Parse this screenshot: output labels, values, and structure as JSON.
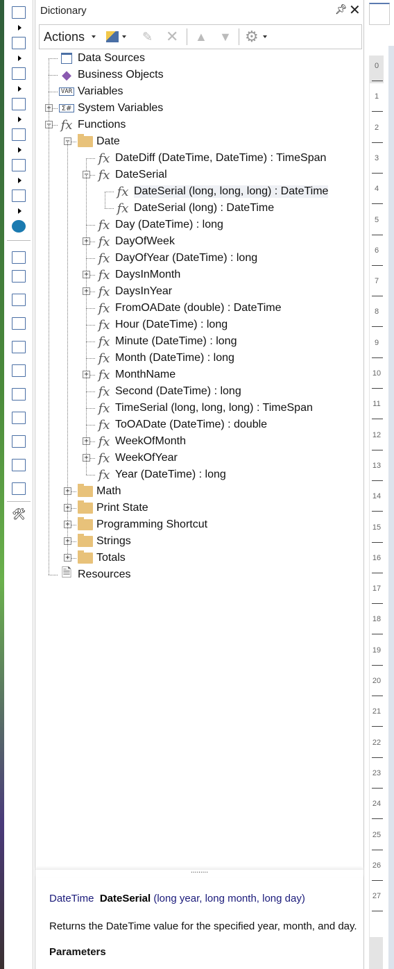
{
  "panel": {
    "title": "Dictionary",
    "pin_icon": "pin-icon",
    "close_icon": "close-icon"
  },
  "toolbar": {
    "actions_label": "Actions"
  },
  "left_toolbar": [
    "page-icon",
    "table-icon",
    "text-icon",
    "barcode-icon",
    "shapes-icon",
    "chart-icon",
    "gauge-icon",
    "map-icon",
    "report-title-band-icon",
    "page-header-band-icon",
    "header-band-icon",
    "footer-band-icon",
    "group-header-icon",
    "group-footer-icon",
    "data-band-icon",
    "hierarchical-band-icon",
    "text-component-icon",
    "image-icon",
    "rich-text-icon",
    "tools-icon"
  ],
  "tree": [
    {
      "level": 0,
      "icon": "data-sources-icon",
      "label": "Data Sources"
    },
    {
      "level": 0,
      "icon": "business-objects-icon",
      "label": "Business Objects"
    },
    {
      "level": 0,
      "icon": "variables-icon",
      "label": "Variables"
    },
    {
      "level": 0,
      "icon": "system-variables-icon",
      "label": "System Variables",
      "exp": "+"
    },
    {
      "level": 0,
      "icon": "function-icon",
      "label": "Functions",
      "exp": "-"
    },
    {
      "level": 1,
      "icon": "folder-icon",
      "label": "Date",
      "exp": "-"
    },
    {
      "level": 2,
      "icon": "function-icon",
      "label": "DateDiff (DateTime, DateTime) : TimeSpan"
    },
    {
      "level": 2,
      "icon": "function-icon",
      "label": "DateSerial",
      "exp": "-"
    },
    {
      "level": 3,
      "icon": "function-icon",
      "label": "DateSerial (long, long, long) : DateTime",
      "selected": true
    },
    {
      "level": 3,
      "icon": "function-icon",
      "label": "DateSerial (long) : DateTime"
    },
    {
      "level": 2,
      "icon": "function-icon",
      "label": "Day (DateTime) : long"
    },
    {
      "level": 2,
      "icon": "function-icon",
      "label": "DayOfWeek",
      "exp": "+"
    },
    {
      "level": 2,
      "icon": "function-icon",
      "label": "DayOfYear (DateTime) : long"
    },
    {
      "level": 2,
      "icon": "function-icon",
      "label": "DaysInMonth",
      "exp": "+"
    },
    {
      "level": 2,
      "icon": "function-icon",
      "label": "DaysInYear",
      "exp": "+"
    },
    {
      "level": 2,
      "icon": "function-icon",
      "label": "FromOADate (double) : DateTime"
    },
    {
      "level": 2,
      "icon": "function-icon",
      "label": "Hour (DateTime) : long"
    },
    {
      "level": 2,
      "icon": "function-icon",
      "label": "Minute (DateTime) : long"
    },
    {
      "level": 2,
      "icon": "function-icon",
      "label": "Month (DateTime) : long"
    },
    {
      "level": 2,
      "icon": "function-icon",
      "label": "MonthName",
      "exp": "+"
    },
    {
      "level": 2,
      "icon": "function-icon",
      "label": "Second (DateTime) : long"
    },
    {
      "level": 2,
      "icon": "function-icon",
      "label": "TimeSerial (long, long, long) : TimeSpan"
    },
    {
      "level": 2,
      "icon": "function-icon",
      "label": "ToOADate (DateTime) : double"
    },
    {
      "level": 2,
      "icon": "function-icon",
      "label": "WeekOfMonth",
      "exp": "+"
    },
    {
      "level": 2,
      "icon": "function-icon",
      "label": "WeekOfYear",
      "exp": "+"
    },
    {
      "level": 2,
      "icon": "function-icon",
      "label": "Year (DateTime) : long"
    },
    {
      "level": 1,
      "icon": "folder-icon",
      "label": "Math",
      "exp": "+"
    },
    {
      "level": 1,
      "icon": "folder-icon",
      "label": "Print State",
      "exp": "+"
    },
    {
      "level": 1,
      "icon": "folder-icon",
      "label": "Programming Shortcut",
      "exp": "+"
    },
    {
      "level": 1,
      "icon": "folder-icon",
      "label": "Strings",
      "exp": "+"
    },
    {
      "level": 1,
      "icon": "folder-icon",
      "label": "Totals",
      "exp": "+"
    },
    {
      "level": 0,
      "icon": "resources-icon",
      "label": "Resources"
    }
  ],
  "description": {
    "return_type": "DateTime",
    "name": "DateSerial",
    "params": "(long year, long month, long day)",
    "text": "Returns the DateTime value for the specified year, month, and day.",
    "parameters_heading": "Parameters",
    "splitter": "........."
  },
  "ruler": [
    "0",
    "1",
    "2",
    "3",
    "4",
    "5",
    "6",
    "7",
    "8",
    "9",
    "10",
    "11",
    "12",
    "13",
    "14",
    "15",
    "16",
    "17",
    "18",
    "19",
    "20",
    "21",
    "22",
    "23",
    "24",
    "25",
    "26",
    "27"
  ]
}
